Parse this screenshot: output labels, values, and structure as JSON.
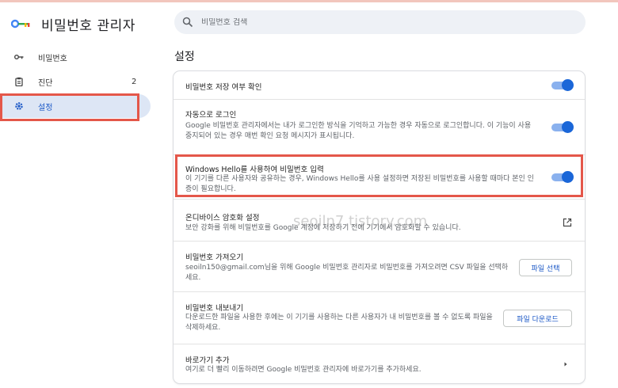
{
  "app": {
    "title": "비밀번호 관리자"
  },
  "search": {
    "placeholder": "비밀번호 검색"
  },
  "sidebar": {
    "items": [
      {
        "label": "비밀번호",
        "badge": ""
      },
      {
        "label": "진단",
        "badge": "2"
      },
      {
        "label": "설정",
        "badge": ""
      }
    ]
  },
  "main": {
    "title": "설정",
    "settings": [
      {
        "title": "비밀번호 저장 여부 확인",
        "toggle": true
      },
      {
        "title": "자동으로 로그인",
        "desc": "Google 비밀번호 관리자에서는 내가 로그인한 방식을 기억하고 가능한 경우 자동으로 로그인합니다. 이 기능이 사용 중지되어 있는 경우 매번 확인 요청 메시지가 표시됩니다.",
        "toggle": true
      },
      {
        "title": "Windows Hello를 사용하여 비밀번호 입력",
        "desc": "이 기기를 다른 사용자와 공유하는 경우, Windows Hello를 사용 설정하면 저장된 비밀번호를 사용할 때마다 본인 인증이 필요합니다.",
        "toggle": true
      },
      {
        "title": "온디바이스 암호화 설정",
        "desc": "보안 강화를 위해 비밀번호를 Google 계정에 저장하기 전에 기기에서 암호화할 수 있습니다."
      },
      {
        "title": "비밀번호 가져오기",
        "desc": "seoiln150@gmail.com님을 위해 Google 비밀번호 관리자로 비밀번호를 가져오려면 CSV 파일을 선택하세요.",
        "button": "파일 선택"
      },
      {
        "title": "비밀번호 내보내기",
        "desc": "다운로드한 파일을 사용한 후에는 이 기기를 사용하는 다른 사용자가 내 비밀번호를 볼 수 없도록 파일을 삭제하세요.",
        "button": "파일 다운로드"
      },
      {
        "title": "바로가기 추가",
        "desc": "여기로 더 빨리 이동하려면 Google 비밀번호 관리자에 바로가기를 추가하세요."
      }
    ]
  },
  "watermark": "seoiln7.tistory.com",
  "colors": {
    "accent": "#1a66d8",
    "toggle_track": "#8ab1ee",
    "highlight": "#e4574a",
    "active_nav": "#dde6f5"
  }
}
